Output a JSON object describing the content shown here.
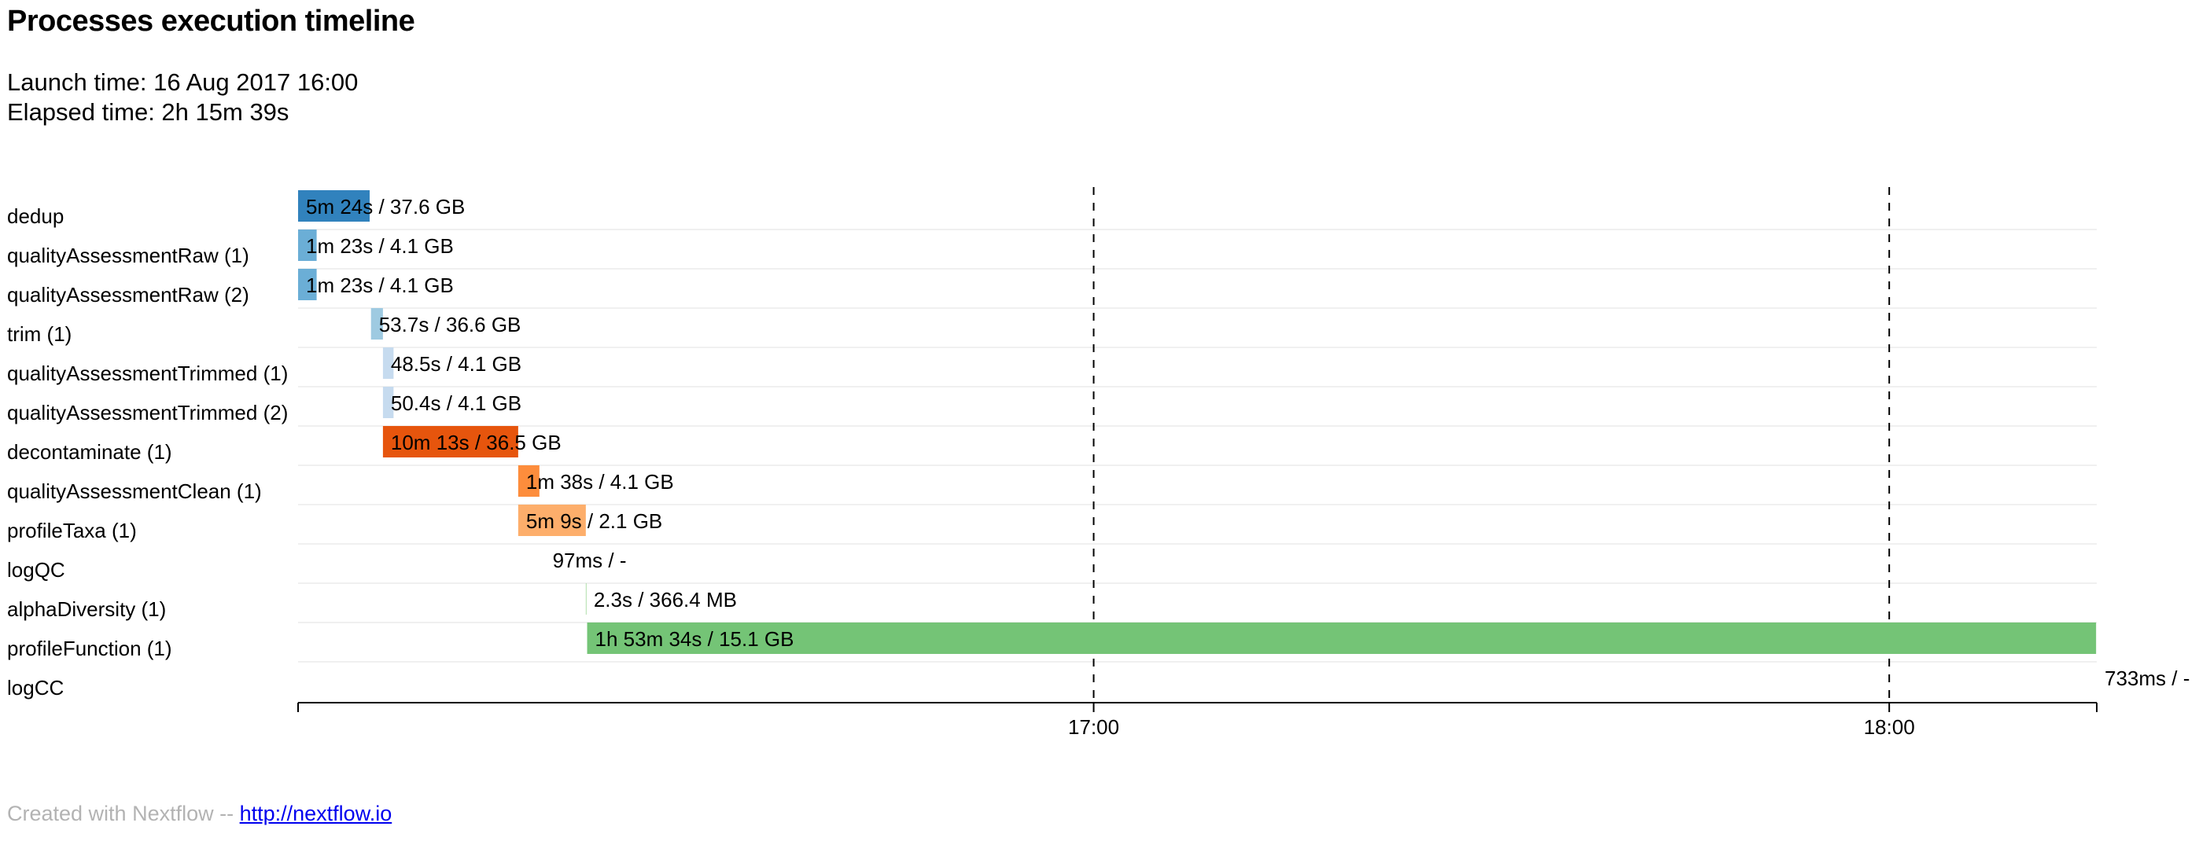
{
  "page": {
    "title": "Processes execution timeline",
    "launch_time_text": "Launch time: 16 Aug 2017 16:00",
    "elapsed_time_text": "Elapsed time: 2h 15m 39s",
    "footer": {
      "text": "Created with Nextflow --",
      "link_text": "http://nextflow.io"
    }
  },
  "chart_data": {
    "type": "bar",
    "orientation": "horizontal-timeline",
    "x_unit": "minutes since launch (16 Aug 2017 16:00)",
    "xlim": [
      0,
      135.65
    ],
    "ticks": [
      {
        "value": 60,
        "label": "17:00"
      },
      {
        "value": 120,
        "label": "18:00"
      }
    ],
    "grid": "dashed vertical lines at ticks",
    "categories": [
      "dedup",
      "qualityAssessmentRaw (1)",
      "qualityAssessmentRaw (2)",
      "trim (1)",
      "qualityAssessmentTrimmed (1)",
      "qualityAssessmentTrimmed (2)",
      "decontaminate (1)",
      "qualityAssessmentClean (1)",
      "profileTaxa (1)",
      "logQC",
      "alphaDiversity (1)",
      "profileFunction (1)",
      "logCC"
    ],
    "tasks": [
      {
        "name": "dedup",
        "start": 0.0,
        "end": 5.4,
        "label": "5m 24s / 37.6 GB",
        "color": "#3182bd"
      },
      {
        "name": "qualityAssessmentRaw (1)",
        "start": 0.0,
        "end": 1.4,
        "label": "1m 23s / 4.1 GB",
        "color": "#6baed6"
      },
      {
        "name": "qualityAssessmentRaw (2)",
        "start": 0.0,
        "end": 1.4,
        "label": "1m 23s / 4.1 GB",
        "color": "#6baed6"
      },
      {
        "name": "trim (1)",
        "start": 5.5,
        "end": 6.4,
        "label": "53.7s / 36.6 GB",
        "color": "#9ecae1"
      },
      {
        "name": "qualityAssessmentTrimmed (1)",
        "start": 6.4,
        "end": 7.2,
        "label": "48.5s / 4.1 GB",
        "color": "#c6dbef"
      },
      {
        "name": "qualityAssessmentTrimmed (2)",
        "start": 6.4,
        "end": 7.2,
        "label": "50.4s / 4.1 GB",
        "color": "#c6dbef"
      },
      {
        "name": "decontaminate (1)",
        "start": 6.4,
        "end": 16.6,
        "label": "10m 13s / 36.5 GB",
        "color": "#e6550d"
      },
      {
        "name": "qualityAssessmentClean (1)",
        "start": 16.6,
        "end": 18.2,
        "label": "1m 38s / 4.1 GB",
        "color": "#fd8d3c"
      },
      {
        "name": "profileTaxa (1)",
        "start": 16.6,
        "end": 21.7,
        "label": "5m 9s / 2.1 GB",
        "color": "#fdae6b"
      },
      {
        "name": "logQC",
        "start": 18.6,
        "end": 18.6,
        "label": "97ms / -",
        "color": "#fdd0a2"
      },
      {
        "name": "alphaDiversity (1)",
        "start": 21.7,
        "end": 21.75,
        "label": "2.3s / 366.4 MB",
        "color": "#a1d99b"
      },
      {
        "name": "profileFunction (1)",
        "start": 21.8,
        "end": 135.6,
        "label": "1h 53m 34s / 15.1 GB",
        "color": "#74c476"
      },
      {
        "name": "logCC",
        "start": 135.65,
        "end": 135.65,
        "label": "733ms / -",
        "color": "#31a354"
      }
    ]
  }
}
